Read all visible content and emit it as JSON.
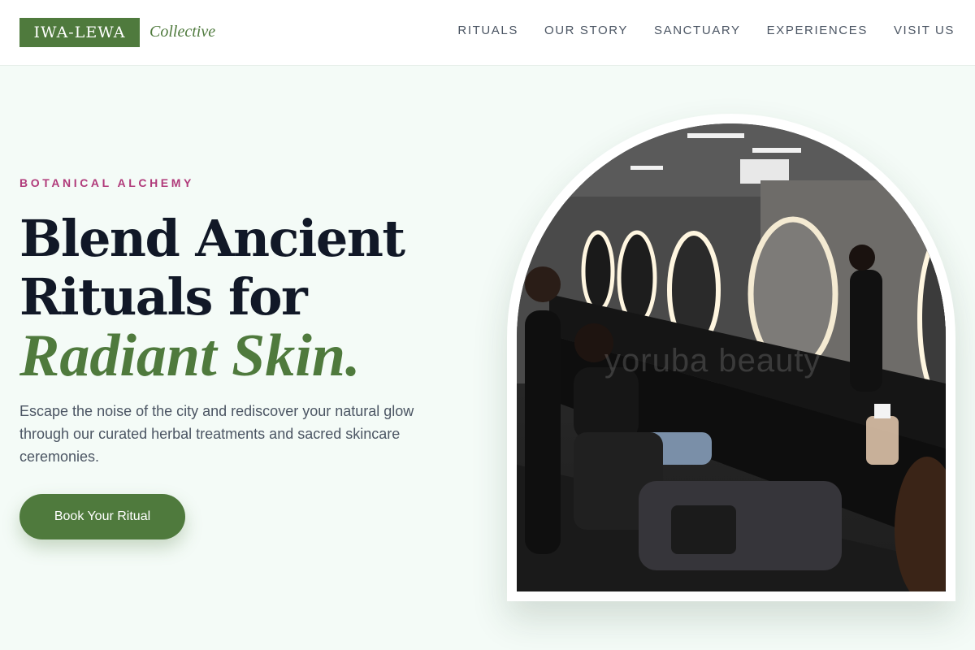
{
  "brand": {
    "name": "IWA-LEWA",
    "tagline": "Collective"
  },
  "nav": {
    "items": [
      "RITUALS",
      "OUR STORY",
      "SANCTUARY",
      "EXPERIENCES",
      "VISIT US"
    ]
  },
  "hero": {
    "eyebrow": "BOTANICAL ALCHEMY",
    "headline_line1": "Blend Ancient",
    "headline_line2": "Rituals for",
    "headline_accent": "Radiant Skin.",
    "description": "Escape the noise of the city and rediscover your natural glow through our curated herbal treatments and sacred skincare ceremonies.",
    "cta_label": "Book Your Ritual"
  },
  "image": {
    "watermark": "yoruba beauty"
  },
  "colors": {
    "brand_green": "#4f7a3d",
    "eyebrow_magenta": "#b03a7a",
    "heading": "#111827",
    "body_text": "#4b5563",
    "page_bg": "#f4fbf7"
  }
}
